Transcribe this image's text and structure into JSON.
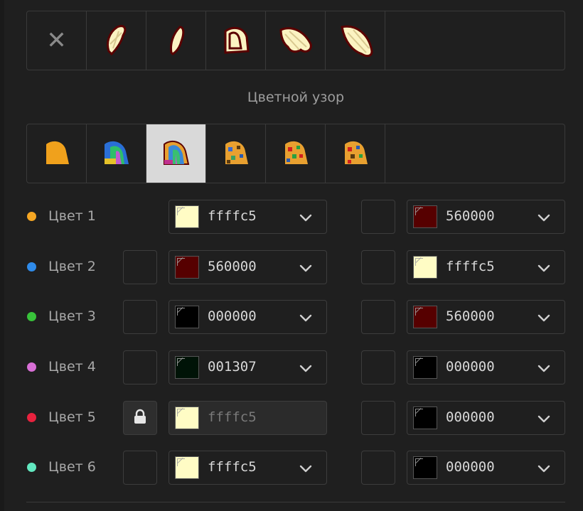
{
  "section_title": "Цветной узор",
  "strip1": {
    "selected_index": 3,
    "items": [
      {
        "icon": "close-icon",
        "glyph": "✕"
      },
      {
        "icon": "wing-variant-1-icon"
      },
      {
        "icon": "wing-variant-2-icon"
      },
      {
        "icon": "wing-variant-3-icon"
      },
      {
        "icon": "wing-variant-4-icon"
      },
      {
        "icon": "wing-variant-5-icon"
      }
    ]
  },
  "strip2": {
    "selected_index": 2,
    "items": [
      {
        "icon": "pattern-solid-icon"
      },
      {
        "icon": "pattern-rainbow-icon"
      },
      {
        "icon": "pattern-rainbow-2-icon"
      },
      {
        "icon": "pattern-spots-icon"
      },
      {
        "icon": "pattern-spots-2-icon"
      },
      {
        "icon": "pattern-spots-3-icon"
      }
    ]
  },
  "colors": [
    {
      "label": "Цвет 1",
      "dot": "#f5a623",
      "left_box": "none",
      "left_color": "#fffcc5",
      "left_value": "ffffc5",
      "left_disabled": false,
      "right_color": "#560000",
      "right_value": "560000"
    },
    {
      "label": "Цвет 2",
      "dot": "#2f8bea",
      "left_box": "empty",
      "left_color": "#560000",
      "left_value": "560000",
      "left_disabled": false,
      "right_color": "#fffcc5",
      "right_value": "ffffc5"
    },
    {
      "label": "Цвет 3",
      "dot": "#38c23a",
      "left_box": "empty",
      "left_color": "#000000",
      "left_value": "000000",
      "left_disabled": false,
      "right_color": "#560000",
      "right_value": "560000"
    },
    {
      "label": "Цвет 4",
      "dot": "#d86fd6",
      "left_box": "empty",
      "left_color": "#001307",
      "left_value": "001307",
      "left_disabled": false,
      "right_color": "#000000",
      "right_value": "000000"
    },
    {
      "label": "Цвет 5",
      "dot": "#e8223e",
      "left_box": "lock",
      "left_color": "#fffcc5",
      "left_value": "ffffc5",
      "left_disabled": true,
      "right_color": "#000000",
      "right_value": "000000"
    },
    {
      "label": "Цвет 6",
      "dot": "#62e8c0",
      "left_box": "empty",
      "left_color": "#fffcc5",
      "left_value": "ffffc5",
      "left_disabled": false,
      "right_color": "#000000",
      "right_value": "000000"
    }
  ]
}
